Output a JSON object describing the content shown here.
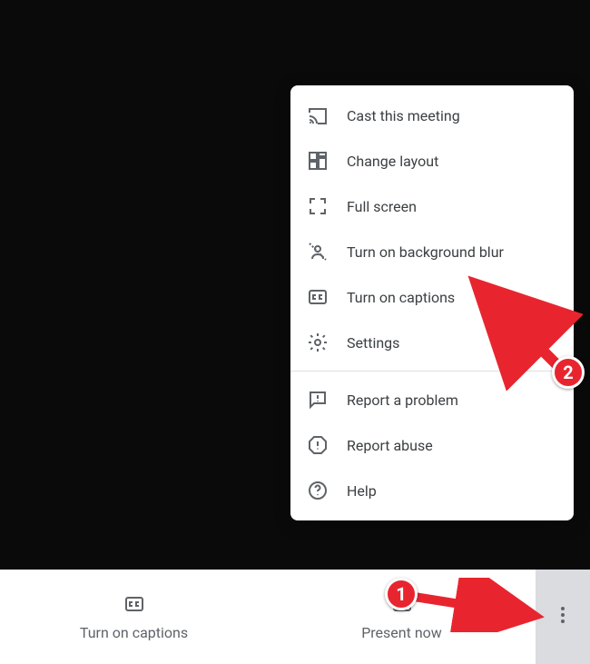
{
  "menu": {
    "items": [
      {
        "label": "Cast this meeting"
      },
      {
        "label": "Change layout"
      },
      {
        "label": "Full screen"
      },
      {
        "label": "Turn on background blur"
      },
      {
        "label": "Turn on captions"
      },
      {
        "label": "Settings"
      }
    ],
    "items2": [
      {
        "label": "Report a problem"
      },
      {
        "label": "Report abuse"
      },
      {
        "label": "Help"
      }
    ]
  },
  "toolbar": {
    "captions_label": "Turn on captions",
    "present_label": "Present now"
  },
  "annotations": {
    "badge1": "1",
    "badge2": "2"
  }
}
